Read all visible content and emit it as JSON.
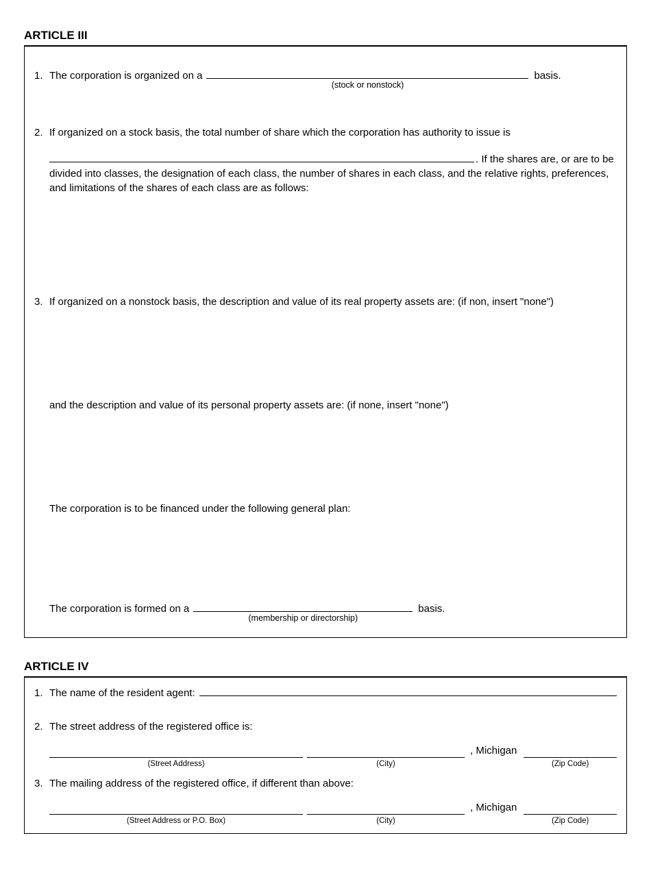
{
  "article3": {
    "heading": "ARTICLE III",
    "item1": {
      "num": "1.",
      "pre": "The corporation is organized on a",
      "sub": "(stock or nonstock)",
      "post": "basis."
    },
    "item2": {
      "num": "2.",
      "line1": "If organized on a stock basis, the total number of share which the corporation has authority to issue is",
      "post_blank": ".  If the shares are, or are to be",
      "wrap": "divided into classes, the designation of each class, the number of shares in each class, and the relative rights, preferences, and limitations of the shares of each class are as follows:"
    },
    "item3": {
      "num": "3.",
      "line1": "If organized on a nonstock basis, the description and value of its real property assets are:  (if non, insert \"none\")",
      "line2": "and the description and value of its personal property assets are:  (if none, insert \"none\")",
      "line3": "The corporation is to be financed under the following general plan:",
      "line4_pre": "The corporation is formed on a",
      "line4_sub": "(membership or directorship)",
      "line4_post": "basis."
    }
  },
  "article4": {
    "heading": "ARTICLE IV",
    "item1": {
      "num": "1.",
      "text": "The name of the resident agent:"
    },
    "item2": {
      "num": "2.",
      "text": "The street address of the registered office is:"
    },
    "item3": {
      "num": "3.",
      "text": "The mailing address of the registered office, if different than above:"
    },
    "state": ", Michigan",
    "captions": {
      "street1": "(Street Address)",
      "street2": "(Street Address or P.O. Box)",
      "city": "(City)",
      "zip": "(Zip Code)"
    }
  }
}
